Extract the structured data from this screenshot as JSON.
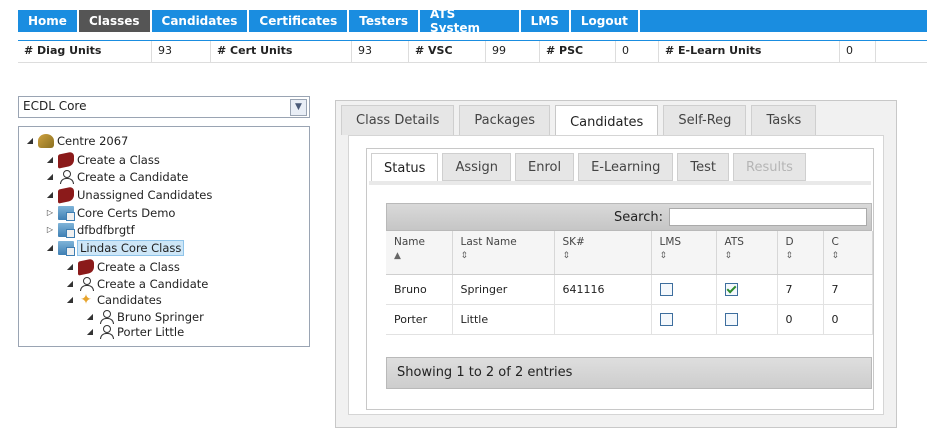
{
  "nav": {
    "items": [
      {
        "label": "Home"
      },
      {
        "label": "Classes"
      },
      {
        "label": "Candidates"
      },
      {
        "label": "Certificates"
      },
      {
        "label": "Testers"
      },
      {
        "label": "ATS System"
      },
      {
        "label": "LMS"
      },
      {
        "label": "Logout"
      }
    ],
    "active": "Classes"
  },
  "stats": [
    {
      "label": "# Diag Units",
      "value": "93"
    },
    {
      "label": "# Cert Units",
      "value": "93"
    },
    {
      "label": "# VSC",
      "value": "99"
    },
    {
      "label": "# PSC",
      "value": "0"
    },
    {
      "label": "# E-Learn Units",
      "value": "0"
    }
  ],
  "course_select": {
    "value": "ECDL Core"
  },
  "tree": {
    "nodes": [
      {
        "label": "Centre 2067",
        "icon": "keys-icon"
      },
      {
        "label": "Create a Class",
        "icon": "book-icon"
      },
      {
        "label": "Create a Candidate",
        "icon": "person-icon"
      },
      {
        "label": "Unassigned Candidates",
        "icon": "book-icon"
      },
      {
        "label": "Core Certs Demo",
        "icon": "folder-icon"
      },
      {
        "label": "dfbdfbrgtf",
        "icon": "folder-icon"
      },
      {
        "label": "Lindas Core Class",
        "icon": "folder-icon"
      },
      {
        "label": "Create a Class",
        "icon": "book-icon"
      },
      {
        "label": "Create a Candidate",
        "icon": "person-icon"
      },
      {
        "label": "Candidates",
        "icon": "star-icon"
      },
      {
        "label": "Bruno Springer",
        "icon": "person-icon"
      },
      {
        "label": "Porter Little",
        "icon": "person-icon"
      }
    ]
  },
  "main_tabs": [
    {
      "label": "Class Details"
    },
    {
      "label": "Packages"
    },
    {
      "label": "Candidates"
    },
    {
      "label": "Self-Reg"
    },
    {
      "label": "Tasks"
    }
  ],
  "sub_tabs": [
    {
      "label": "Status"
    },
    {
      "label": "Assign"
    },
    {
      "label": "Enrol"
    },
    {
      "label": "E-Learning"
    },
    {
      "label": "Test"
    },
    {
      "label": "Results"
    }
  ],
  "search": {
    "label": "Search:"
  },
  "table": {
    "columns": [
      "Name",
      "Last Name",
      "SK#",
      "LMS",
      "ATS",
      "D",
      "C"
    ],
    "rows": [
      {
        "name": "Bruno",
        "last": "Springer",
        "sk": "641116",
        "lms": false,
        "ats": true,
        "d": "7",
        "c": "7"
      },
      {
        "name": "Porter",
        "last": "Little",
        "sk": "",
        "lms": false,
        "ats": false,
        "d": "0",
        "c": "0"
      }
    ]
  },
  "footer": {
    "info": "Showing 1 to 2 of 2 entries"
  }
}
